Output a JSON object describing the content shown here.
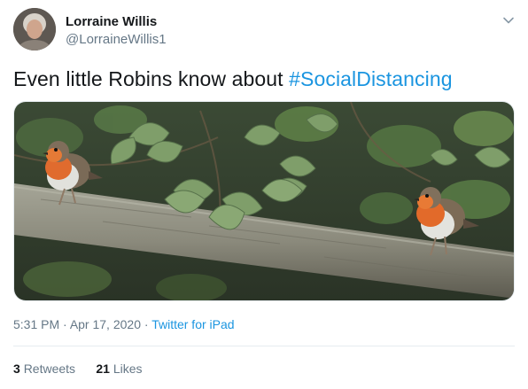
{
  "author": {
    "name": "Lorraine Willis",
    "handle": "@LorraineWillis1"
  },
  "icons": {
    "menu": "chevron-down-icon"
  },
  "tweet": {
    "text_prefix": "Even little Robins know about ",
    "hashtag": "#SocialDistancing"
  },
  "meta": {
    "time": "5:31 PM",
    "sep1": " · ",
    "date": "Apr 17, 2020",
    "sep2": " · ",
    "source": "Twitter for iPad"
  },
  "stats": {
    "retweets_count": "3",
    "retweets_label": "Retweets",
    "likes_count": "21",
    "likes_label": "Likes"
  },
  "colors": {
    "link": "#1b95e0",
    "secondary_text": "#657786",
    "primary_text": "#14171a",
    "divider": "#e6ecf0"
  }
}
